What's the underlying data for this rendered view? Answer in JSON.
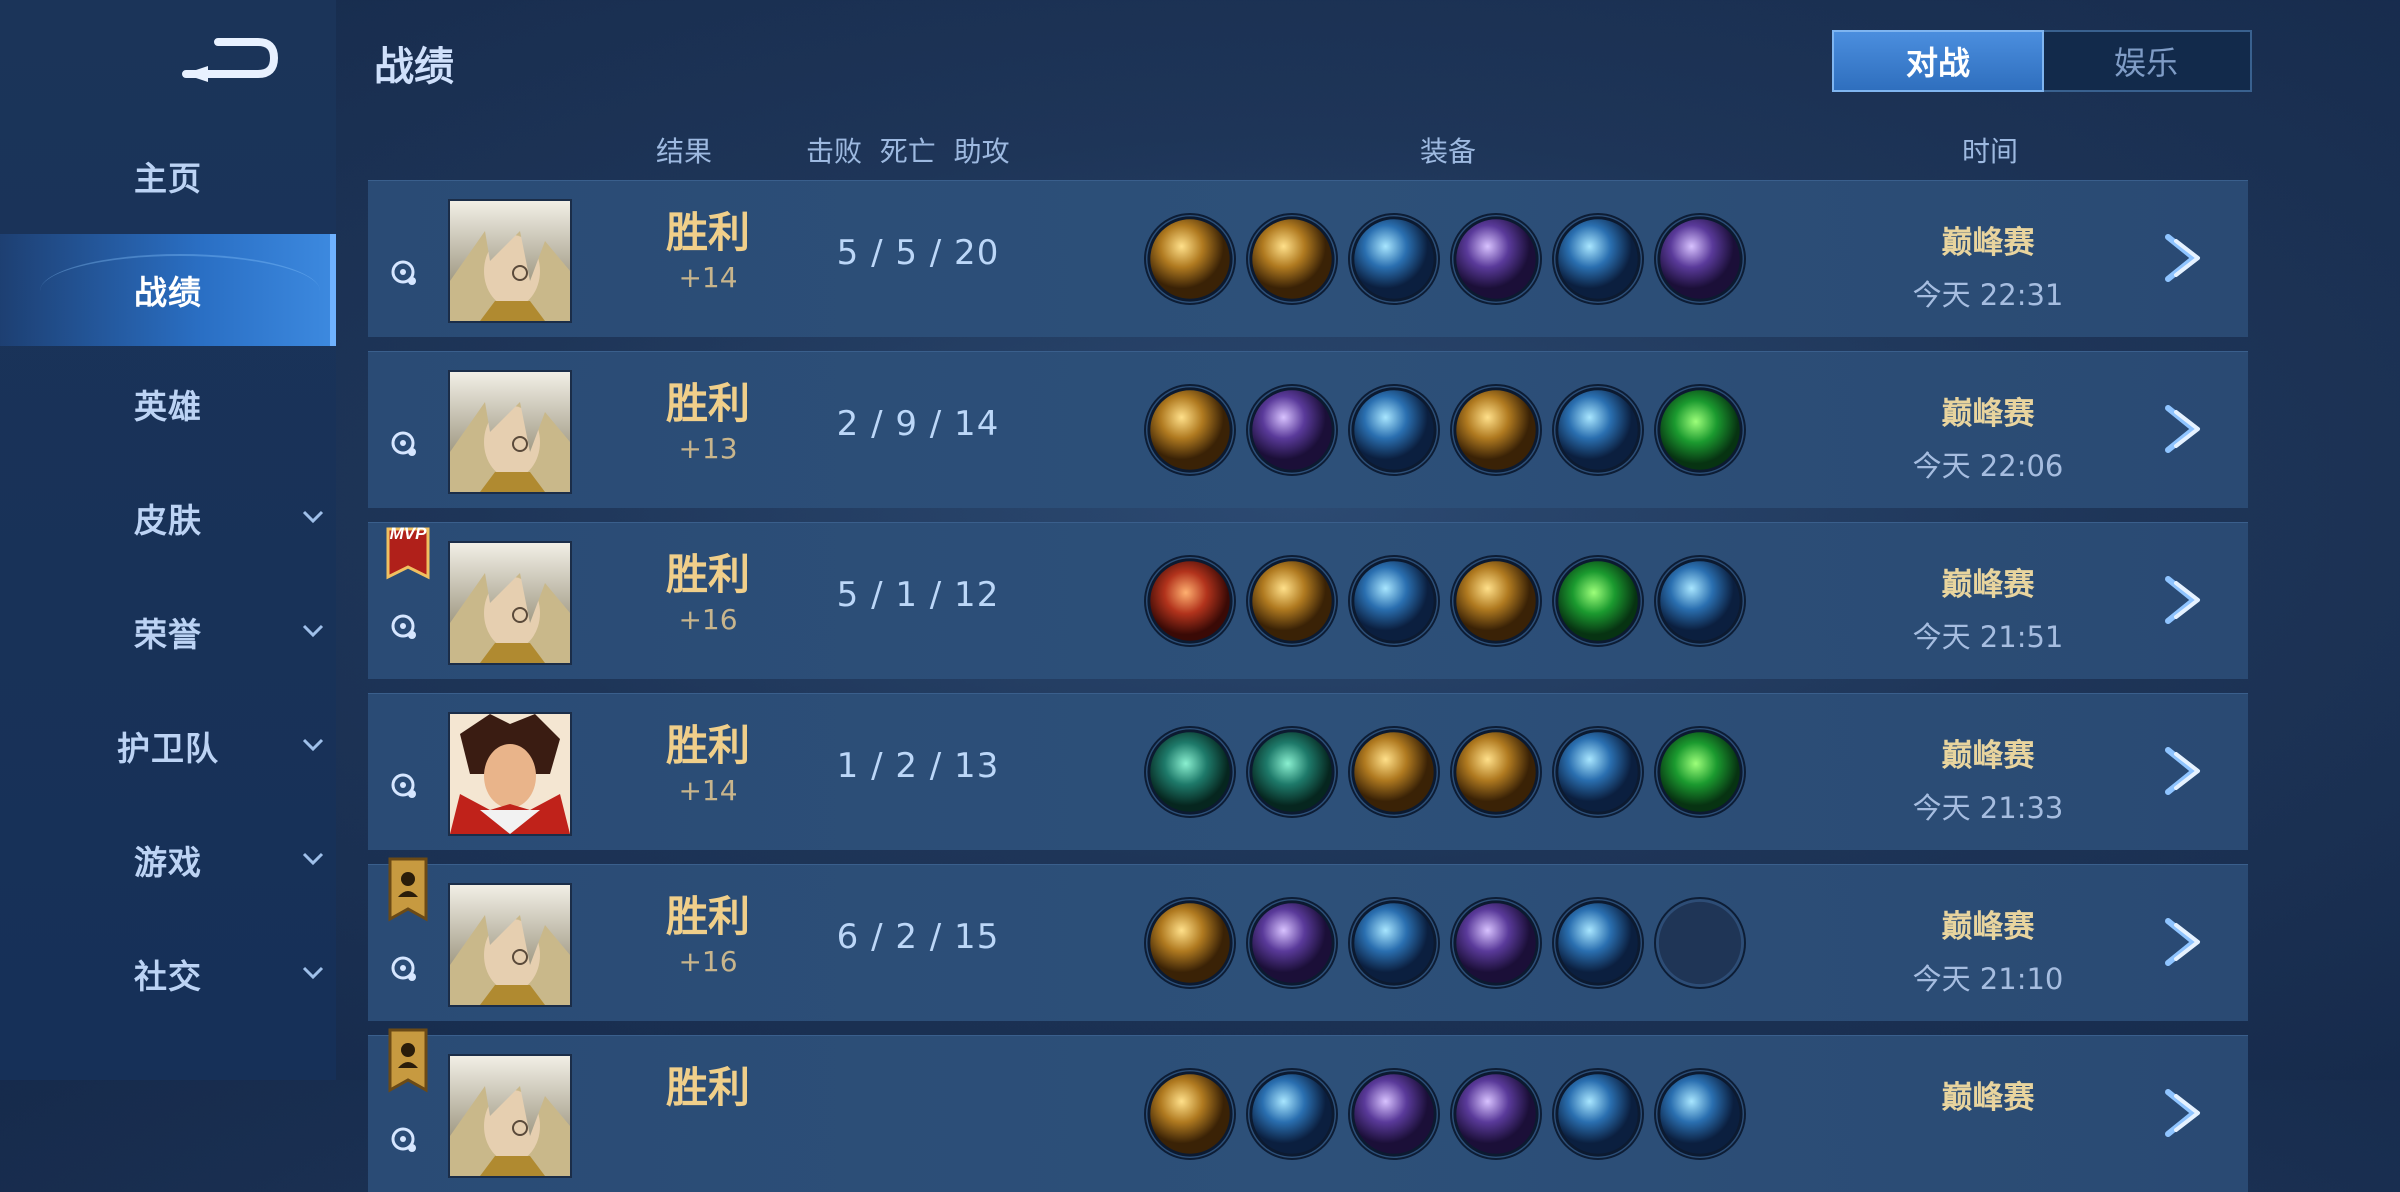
{
  "sidebar": {
    "items": [
      {
        "label": "主页",
        "has_chevron": false
      },
      {
        "label": "战绩",
        "has_chevron": false,
        "active": true
      },
      {
        "label": "英雄",
        "has_chevron": false
      },
      {
        "label": "皮肤",
        "has_chevron": true
      },
      {
        "label": "荣誉",
        "has_chevron": true
      },
      {
        "label": "护卫队",
        "has_chevron": true
      },
      {
        "label": "游戏",
        "has_chevron": true
      },
      {
        "label": "社交",
        "has_chevron": true
      }
    ]
  },
  "header": {
    "title": "战绩",
    "toggle": {
      "active": "对战",
      "inactive": "娱乐"
    }
  },
  "columns": {
    "result": "结果",
    "kda": "击败  死亡  助攻",
    "items": "装备",
    "time": "时间"
  },
  "matches": [
    {
      "result": "胜利",
      "delta": "+14",
      "kda": "5 / 5 / 20",
      "mode": "巅峰赛",
      "time": "今天 22:31",
      "badge": "",
      "hero": "blonde-hero"
    },
    {
      "result": "胜利",
      "delta": "+13",
      "kda": "2 / 9 / 14",
      "mode": "巅峰赛",
      "time": "今天 22:06",
      "badge": "",
      "hero": "blonde-hero"
    },
    {
      "result": "胜利",
      "delta": "+16",
      "kda": "5 / 1 / 12",
      "mode": "巅峰赛",
      "time": "今天 21:51",
      "badge": "MVP",
      "hero": "blonde-hero"
    },
    {
      "result": "胜利",
      "delta": "+14",
      "kda": "1 / 2 / 13",
      "mode": "巅峰赛",
      "time": "今天 21:33",
      "badge": "",
      "hero": "red-hero"
    },
    {
      "result": "胜利",
      "delta": "+16",
      "kda": "6 / 2 / 15",
      "mode": "巅峰赛",
      "time": "今天 21:10",
      "badge": "banner",
      "hero": "blonde-hero"
    },
    {
      "result": "胜利",
      "delta": "",
      "kda": "",
      "mode": "巅峰赛",
      "time": "",
      "badge": "banner",
      "hero": "blonde-hero"
    }
  ],
  "colors": {
    "accent": "#3d8ae0",
    "win": "#f0cf8a",
    "panel": "#2a4b75"
  }
}
